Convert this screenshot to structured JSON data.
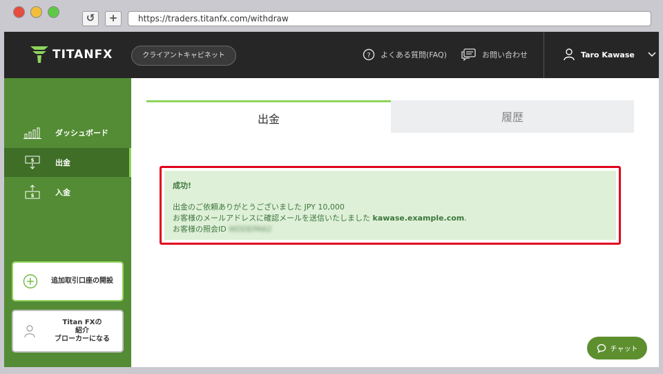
{
  "browser": {
    "url": "https://traders.titanfx.com/withdraw",
    "reload_glyph": "↺",
    "newtab_glyph": "+"
  },
  "header": {
    "logo_text": "TITANFX",
    "cabinet_label": "クライアントキャビネット",
    "faq_label": "よくある質問(FAQ)",
    "contact_label": "お問い合わせ",
    "user_name": "Taro Kawase"
  },
  "sidebar": {
    "items": [
      {
        "label": "ダッシュボード",
        "icon": "bar-chart-icon"
      },
      {
        "label": "出金",
        "icon": "withdraw-icon"
      },
      {
        "label": "入金",
        "icon": "deposit-icon"
      }
    ],
    "promo_open_label": "追加取引口座の開設",
    "promo_ib_line1": "Titan FXの",
    "promo_ib_line2": "紹介",
    "promo_ib_line3": "ブローカーになる"
  },
  "tabs": {
    "withdraw": "出金",
    "history": "履歴"
  },
  "alert": {
    "title": "成功!",
    "line1": "出金のご依頼ありがとうございました JPY 10,000",
    "line2_prefix": "お客様のメールアドレスに確認メールを送信いたしました ",
    "email": "kawase.example.com",
    "line2_suffix": ".",
    "line3_prefix": "お客様の照会ID ",
    "reference_id": "WDDEPA62"
  },
  "chat_label": "チャット",
  "colors": {
    "header_bg": "#262626",
    "sidebar_bg": "#538c34",
    "accent": "#8fd45d",
    "alert_border": "#e0001b",
    "alert_bg": "#dff0d8"
  }
}
